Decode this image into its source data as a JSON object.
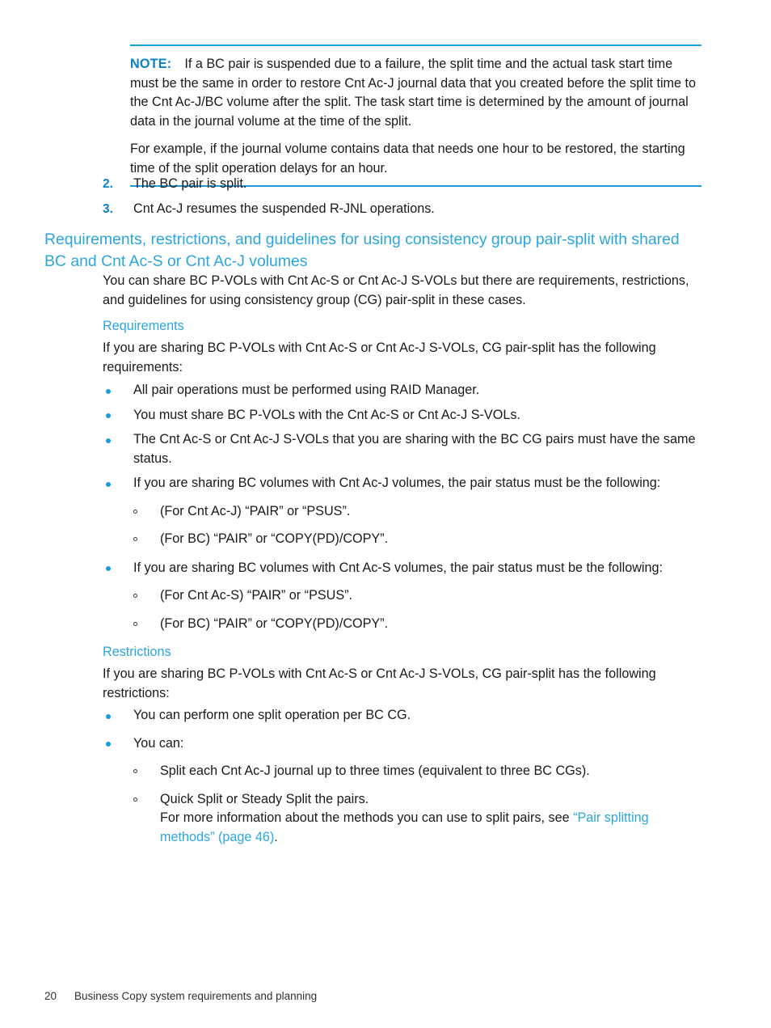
{
  "note": {
    "label": "NOTE:",
    "paragraphs": [
      "If a BC pair is suspended due to a failure, the split time and the actual task start time must be the same in order to restore Cnt Ac-J journal data that you created before the split time to the Cnt Ac-J/BC volume after the split. The task start time is determined by the amount of journal data in the journal volume at the time of the split.",
      "For example, if the journal volume contains data that needs one hour to be restored, the starting time of the split operation delays for an hour."
    ]
  },
  "steps": [
    {
      "marker": "2.",
      "text": "The BC pair is split."
    },
    {
      "marker": "3.",
      "text": "Cnt Ac-J resumes the suspended R-JNL operations."
    }
  ],
  "section": {
    "heading": "Requirements, restrictions, and guidelines for using consistency group pair-split with shared BC and Cnt Ac-S or Cnt Ac-J volumes",
    "intro": "You can share BC P-VOLs with Cnt Ac-S or Cnt Ac-J S-VOLs but there are requirements, restrictions, and guidelines for using consistency group (CG) pair-split in these cases."
  },
  "requirements": {
    "heading": "Requirements",
    "intro": "If you are sharing BC P-VOLs with Cnt Ac-S or Cnt Ac-J S-VOLs, CG pair-split has the following requirements:",
    "bullets": [
      "All pair operations must be performed using RAID Manager.",
      "You must share BC P-VOLs with the Cnt Ac-S or Cnt Ac-J S-VOLs.",
      "The Cnt Ac-S or Cnt Ac-J S-VOLs that you are sharing with the BC CG pairs must have the same status.",
      "If you are sharing BC volumes with Cnt Ac-J volumes, the pair status must be the following:"
    ],
    "sub_acj": [
      "(For Cnt Ac-J) “PAIR” or “PSUS”.",
      "(For BC) “PAIR” or “COPY(PD)/COPY”."
    ],
    "bullet_acs": "If you are sharing BC volumes with Cnt Ac-S volumes, the pair status must be the following:",
    "sub_acs": [
      "(For Cnt Ac-S) “PAIR” or “PSUS”.",
      "(For BC) “PAIR” or “COPY(PD)/COPY”."
    ]
  },
  "restrictions": {
    "heading": "Restrictions",
    "intro": "If you are sharing BC P-VOLs with Cnt Ac-S or Cnt Ac-J S-VOLs, CG pair-split has the following restrictions:",
    "bullets": [
      "You can perform one split operation per BC CG.",
      "You can:"
    ],
    "sub": [
      "Split each Cnt Ac-J journal up to three times (equivalent to three BC CGs).",
      "Quick Split or Steady Split the pairs."
    ],
    "xref_lead": "For more information about the methods you can use to split pairs, see ",
    "xref_text": "“Pair splitting methods” (page 46)",
    "xref_tail": "."
  },
  "footer": {
    "page_number": "20",
    "chapter": "Business Copy system requirements and planning"
  },
  "colors": {
    "accent_blue": "#2ba6de",
    "rule_blue": "#1a9fdc",
    "note_label_blue": "#0b82c4",
    "body_text": "#1a1a1a"
  }
}
